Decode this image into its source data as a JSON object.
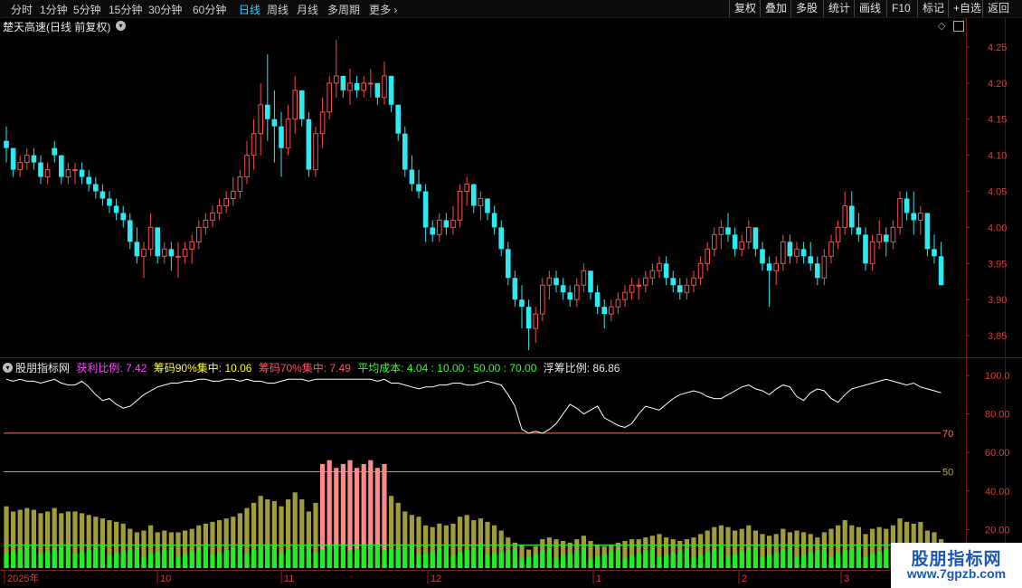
{
  "toolbar": {
    "periods": [
      "分时",
      "1分钟",
      "5分钟",
      "15分钟",
      "30分钟",
      "60分钟",
      "日线",
      "周线",
      "月线",
      "多周期",
      "更多"
    ],
    "active_period": "日线",
    "right_buttons": [
      "复权",
      "叠加",
      "多股",
      "统计",
      "画线",
      "F10",
      "标记",
      "+自选",
      "返回"
    ]
  },
  "stock": {
    "title": "楚天高速(日线 前复权)",
    "price_axis": [
      "4.25",
      "4.20",
      "4.15",
      "4.10",
      "4.05",
      "4.00",
      "3.95",
      "3.90",
      "3.85"
    ]
  },
  "indicator": {
    "name": "股朋指标网",
    "profit_label": "获利比例:",
    "profit_value": "7.42",
    "chip90_label": "筹码90%集中:",
    "chip90_value": "10.06",
    "chip70_label": "筹码70%集中:",
    "chip70_value": "7.49",
    "avgcost_label": "平均成本:",
    "avgcost_value": "4.04",
    "ref_values": ": 10.00 : 50.00 : 70.00",
    "float_label": "浮筹比例:",
    "float_value": "86.86",
    "axis": [
      "100.0",
      "80.00",
      "60.00",
      "40.00",
      "20.00"
    ],
    "line70_label": "70",
    "line50_label": "50"
  },
  "time_axis": [
    "2025年",
    "10",
    "11",
    "12",
    "1",
    "2",
    "3"
  ],
  "watermark": {
    "line1": "股朋指标网",
    "line2": "www.7gpzb.com"
  },
  "colors": {
    "up": "#ff4a4a",
    "down": "#2fe8f0",
    "chip_bar": "#a09c3c",
    "chip_hot": "#ff8a8a",
    "green_bar": "#22ee22",
    "profit": "#ff44ff",
    "chip90": "#ffff33",
    "chip70": "#ff5566",
    "avg": "#33ff33"
  },
  "chart_data": {
    "type": "candlestick",
    "candles": [
      [
        4.12,
        4.14,
        4.09,
        4.11
      ],
      [
        4.11,
        4.11,
        4.07,
        4.08
      ],
      [
        4.08,
        4.1,
        4.07,
        4.09
      ],
      [
        4.09,
        4.11,
        4.08,
        4.1
      ],
      [
        4.1,
        4.11,
        4.08,
        4.09
      ],
      [
        4.09,
        4.1,
        4.06,
        4.07
      ],
      [
        4.07,
        4.09,
        4.06,
        4.08
      ],
      [
        4.11,
        4.12,
        4.09,
        4.1
      ],
      [
        4.1,
        4.1,
        4.06,
        4.07
      ],
      [
        4.07,
        4.09,
        4.06,
        4.08
      ],
      [
        4.08,
        4.09,
        4.06,
        4.08
      ],
      [
        4.08,
        4.09,
        4.06,
        4.07
      ],
      [
        4.07,
        4.08,
        4.05,
        4.06
      ],
      [
        4.06,
        4.07,
        4.04,
        4.05
      ],
      [
        4.05,
        4.06,
        4.03,
        4.04
      ],
      [
        4.04,
        4.05,
        4.02,
        4.03
      ],
      [
        4.03,
        4.04,
        4.01,
        4.02
      ],
      [
        4.02,
        4.03,
        4.0,
        4.01
      ],
      [
        4.01,
        4.02,
        3.97,
        3.98
      ],
      [
        3.98,
        4.0,
        3.95,
        3.96
      ],
      [
        3.96,
        3.98,
        3.93,
        3.97
      ],
      [
        3.97,
        4.02,
        3.96,
        4.0
      ],
      [
        4.0,
        4.0,
        3.95,
        3.96
      ],
      [
        3.96,
        3.98,
        3.95,
        3.97
      ],
      [
        3.97,
        3.98,
        3.94,
        3.96
      ],
      [
        3.96,
        3.98,
        3.93,
        3.96
      ],
      [
        3.96,
        3.98,
        3.95,
        3.97
      ],
      [
        3.97,
        3.99,
        3.95,
        3.98
      ],
      [
        3.98,
        4.01,
        3.97,
        4.0
      ],
      [
        4.0,
        4.02,
        3.99,
        4.01
      ],
      [
        4.01,
        4.03,
        4.0,
        4.02
      ],
      [
        4.02,
        4.04,
        4.01,
        4.03
      ],
      [
        4.03,
        4.05,
        4.02,
        4.04
      ],
      [
        4.04,
        4.07,
        4.03,
        4.05
      ],
      [
        4.05,
        4.08,
        4.04,
        4.07
      ],
      [
        4.07,
        4.12,
        4.06,
        4.1
      ],
      [
        4.1,
        4.15,
        4.08,
        4.13
      ],
      [
        4.13,
        4.2,
        4.1,
        4.17
      ],
      [
        4.17,
        4.24,
        4.12,
        4.15
      ],
      [
        4.15,
        4.19,
        4.09,
        4.14
      ],
      [
        4.14,
        4.16,
        4.07,
        4.11
      ],
      [
        4.11,
        4.17,
        4.1,
        4.15
      ],
      [
        4.15,
        4.21,
        4.13,
        4.19
      ],
      [
        4.19,
        4.19,
        4.14,
        4.15
      ],
      [
        4.15,
        4.16,
        4.07,
        4.08
      ],
      [
        4.08,
        4.14,
        4.07,
        4.13
      ],
      [
        4.13,
        4.18,
        4.11,
        4.16
      ],
      [
        4.16,
        4.21,
        4.15,
        4.2
      ],
      [
        4.2,
        4.26,
        4.18,
        4.21
      ],
      [
        4.21,
        4.21,
        4.18,
        4.19
      ],
      [
        4.19,
        4.22,
        4.17,
        4.2
      ],
      [
        4.2,
        4.21,
        4.18,
        4.19
      ],
      [
        4.19,
        4.21,
        4.18,
        4.2
      ],
      [
        4.2,
        4.22,
        4.18,
        4.2
      ],
      [
        4.2,
        4.2,
        4.17,
        4.18
      ],
      [
        4.18,
        4.23,
        4.17,
        4.21
      ],
      [
        4.21,
        4.21,
        4.16,
        4.17
      ],
      [
        4.17,
        4.17,
        4.12,
        4.13
      ],
      [
        4.13,
        4.14,
        4.07,
        4.08
      ],
      [
        4.08,
        4.1,
        4.05,
        4.06
      ],
      [
        4.06,
        4.08,
        4.04,
        4.05
      ],
      [
        4.05,
        4.06,
        3.98,
        4.0
      ],
      [
        4.0,
        4.01,
        3.98,
        3.99
      ],
      [
        3.99,
        4.02,
        3.98,
        4.01
      ],
      [
        4.01,
        4.02,
        3.99,
        4.0
      ],
      [
        4.0,
        4.03,
        3.99,
        4.01
      ],
      [
        4.01,
        4.06,
        4.0,
        4.05
      ],
      [
        4.05,
        4.07,
        4.03,
        4.06
      ],
      [
        4.06,
        4.06,
        4.02,
        4.03
      ],
      [
        4.03,
        4.05,
        4.01,
        4.04
      ],
      [
        4.04,
        4.04,
        4.01,
        4.02
      ],
      [
        4.02,
        4.03,
        3.99,
        4.0
      ],
      [
        4.0,
        4.01,
        3.96,
        3.97
      ],
      [
        3.97,
        3.98,
        3.92,
        3.93
      ],
      [
        3.93,
        3.94,
        3.89,
        3.9
      ],
      [
        3.9,
        3.92,
        3.86,
        3.89
      ],
      [
        3.89,
        3.9,
        3.83,
        3.86
      ],
      [
        3.86,
        3.89,
        3.84,
        3.88
      ],
      [
        3.88,
        3.93,
        3.87,
        3.92
      ],
      [
        3.92,
        3.94,
        3.9,
        3.93
      ],
      [
        3.93,
        3.94,
        3.91,
        3.92
      ],
      [
        3.92,
        3.93,
        3.9,
        3.91
      ],
      [
        3.91,
        3.92,
        3.89,
        3.9
      ],
      [
        3.9,
        3.93,
        3.89,
        3.92
      ],
      [
        3.92,
        3.95,
        3.91,
        3.94
      ],
      [
        3.94,
        3.94,
        3.9,
        3.91
      ],
      [
        3.91,
        3.92,
        3.88,
        3.89
      ],
      [
        3.89,
        3.9,
        3.86,
        3.88
      ],
      [
        3.88,
        3.9,
        3.87,
        3.89
      ],
      [
        3.89,
        3.91,
        3.88,
        3.9
      ],
      [
        3.9,
        3.92,
        3.89,
        3.91
      ],
      [
        3.91,
        3.93,
        3.9,
        3.92
      ],
      [
        3.92,
        3.93,
        3.9,
        3.92
      ],
      [
        3.92,
        3.94,
        3.91,
        3.93
      ],
      [
        3.93,
        3.95,
        3.92,
        3.94
      ],
      [
        3.94,
        3.96,
        3.93,
        3.95
      ],
      [
        3.95,
        3.96,
        3.92,
        3.93
      ],
      [
        3.93,
        3.94,
        3.91,
        3.92
      ],
      [
        3.92,
        3.93,
        3.9,
        3.91
      ],
      [
        3.91,
        3.93,
        3.9,
        3.92
      ],
      [
        3.92,
        3.94,
        3.91,
        3.93
      ],
      [
        3.93,
        3.96,
        3.92,
        3.95
      ],
      [
        3.95,
        3.98,
        3.94,
        3.97
      ],
      [
        3.97,
        4.0,
        3.96,
        3.99
      ],
      [
        3.99,
        4.01,
        3.97,
        4.0
      ],
      [
        4.0,
        4.02,
        3.98,
        3.99
      ],
      [
        3.99,
        4.0,
        3.96,
        3.97
      ],
      [
        3.97,
        3.99,
        3.96,
        3.98
      ],
      [
        3.98,
        4.01,
        3.97,
        4.0
      ],
      [
        4.0,
        4.0,
        3.96,
        3.97
      ],
      [
        3.97,
        3.98,
        3.94,
        3.95
      ],
      [
        3.95,
        3.96,
        3.89,
        3.94
      ],
      [
        3.94,
        3.96,
        3.92,
        3.95
      ],
      [
        3.95,
        3.99,
        3.94,
        3.98
      ],
      [
        3.98,
        3.99,
        3.95,
        3.96
      ],
      [
        3.96,
        3.98,
        3.95,
        3.97
      ],
      [
        3.97,
        3.98,
        3.95,
        3.96
      ],
      [
        3.96,
        3.98,
        3.94,
        3.95
      ],
      [
        3.95,
        3.96,
        3.92,
        3.93
      ],
      [
        3.93,
        3.97,
        3.92,
        3.96
      ],
      [
        3.96,
        3.99,
        3.95,
        3.98
      ],
      [
        3.98,
        4.01,
        3.97,
        4.0
      ],
      [
        4.0,
        4.05,
        3.99,
        4.03
      ],
      [
        4.03,
        4.05,
        3.99,
        4.0
      ],
      [
        4.0,
        4.02,
        3.98,
        3.99
      ],
      [
        3.99,
        4.0,
        3.94,
        3.95
      ],
      [
        3.95,
        3.99,
        3.94,
        3.98
      ],
      [
        3.98,
        4.01,
        3.97,
        3.99
      ],
      [
        3.99,
        4.0,
        3.96,
        3.98
      ],
      [
        3.98,
        4.01,
        3.97,
        4.0
      ],
      [
        4.0,
        4.05,
        3.99,
        4.04
      ],
      [
        4.04,
        4.05,
        4.01,
        4.02
      ],
      [
        4.02,
        4.05,
        3.99,
        4.01
      ],
      [
        4.01,
        4.03,
        3.99,
        4.02
      ],
      [
        4.02,
        4.02,
        3.96,
        3.97
      ],
      [
        3.97,
        3.99,
        3.95,
        3.96
      ],
      [
        3.96,
        3.98,
        3.92,
        3.92
      ]
    ],
    "float_ratio": [
      98,
      97,
      98,
      97,
      97,
      96,
      97,
      98,
      96,
      95,
      95,
      97,
      94,
      90,
      87,
      88,
      85,
      83,
      84,
      87,
      90,
      92,
      94,
      95,
      96,
      96,
      97,
      97,
      98,
      98,
      97,
      97,
      98,
      98,
      97,
      98,
      97,
      97,
      96,
      96,
      97,
      98,
      98,
      98,
      97,
      98,
      98,
      98,
      98,
      98,
      98,
      98,
      98,
      98,
      97,
      98,
      96,
      96,
      95,
      94,
      93,
      94,
      94,
      95,
      95,
      96,
      96,
      95,
      95,
      96,
      97,
      96,
      95,
      90,
      84,
      72,
      70,
      71,
      70,
      72,
      75,
      80,
      85,
      83,
      80,
      82,
      84,
      78,
      76,
      74,
      73,
      75,
      80,
      84,
      83,
      82,
      85,
      88,
      90,
      91,
      92,
      91,
      89,
      88,
      88,
      90,
      92,
      94,
      95,
      93,
      92,
      90,
      93,
      95,
      94,
      89,
      87,
      91,
      93,
      92,
      88,
      86,
      90,
      93,
      94,
      95,
      96,
      97,
      98,
      97,
      96,
      95,
      96,
      94,
      93,
      92,
      91,
      89,
      87
    ]
  }
}
